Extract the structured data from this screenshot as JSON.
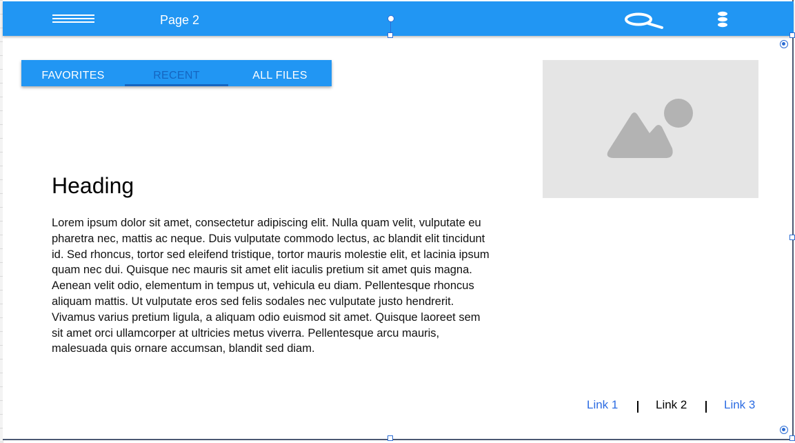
{
  "appbar": {
    "title": "Page 2",
    "menu_icon": "hamburger-menu-icon",
    "search_icon": "search-icon",
    "more_icon": "more-vertical-icon",
    "color": "#2196f3"
  },
  "tabs": {
    "items": [
      {
        "label": "FAVORITES",
        "active": false
      },
      {
        "label": "RECENT",
        "active": true
      },
      {
        "label": "ALL FILES",
        "active": false
      }
    ],
    "active_color": "#1565c0"
  },
  "content": {
    "heading": "Heading",
    "body": "Lorem ipsum dolor sit amet, consectetur adipiscing elit. Nulla quam velit, vulputate eu pharetra nec, mattis ac neque. Duis vulputate commodo lectus, ac blandit elit tincidunt id. Sed rhoncus, tortor sed eleifend tristique, tortor mauris molestie elit, et lacinia ipsum quam nec dui. Quisque nec mauris sit amet elit iaculis pretium sit amet quis magna. Aenean velit odio, elementum in tempus ut, vehicula eu diam. Pellentesque rhoncus aliquam mattis. Ut vulputate eros sed felis sodales nec vulputate justo hendrerit. Vivamus varius pretium ligula, a aliquam odio euismod sit amet. Quisque laoreet sem sit amet orci ullamcorper at ultricies metus viverra. Pellentesque arcu mauris, malesuada quis ornare accumsan, blandit sed diam."
  },
  "image": {
    "icon": "image-placeholder-icon",
    "background": "#e5e5e5"
  },
  "footer": {
    "links": [
      {
        "label": "Link 1"
      },
      {
        "label": "Link 2"
      },
      {
        "label": "Link 3"
      }
    ],
    "link_color": "#2b6be2"
  }
}
